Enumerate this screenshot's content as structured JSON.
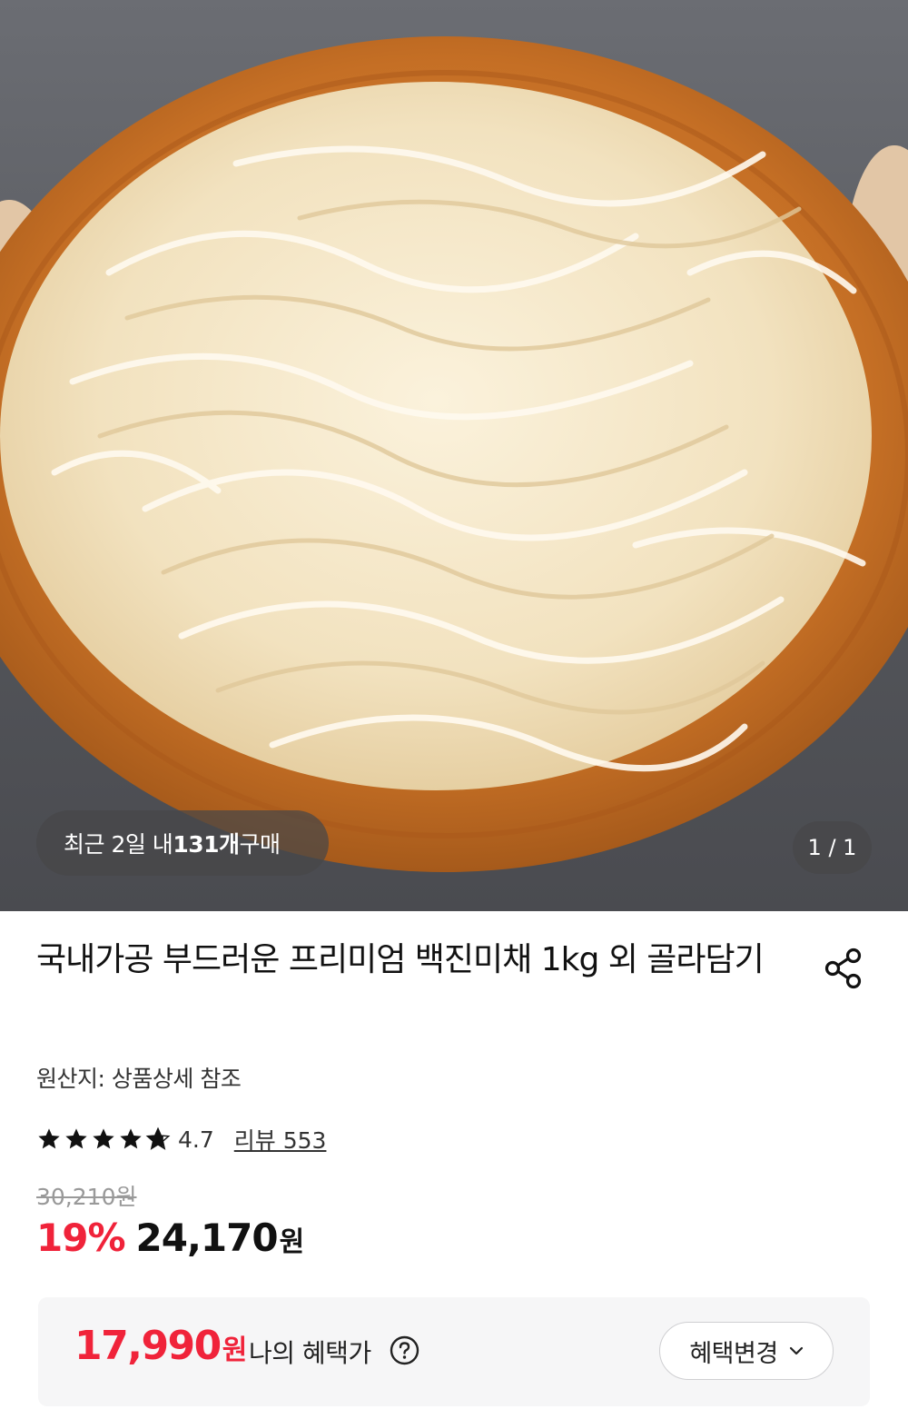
{
  "hero": {
    "image_alt": "wooden plate of shredded dried squid",
    "recent_purchase": {
      "prefix": "최근 2일 내 ",
      "count": "131개",
      "suffix": " 구매"
    },
    "counter": "1 / 1"
  },
  "product": {
    "title": "국내가공 부드러운 프리미엄 백진미채 1kg 외 골라담기",
    "origin": "원산지: 상품상세 참조",
    "rating": "4.7",
    "rating_value": 4.7,
    "review_link": "리뷰 553",
    "original_price": "30,210원",
    "discount": "19%",
    "price": "24,170",
    "price_unit": "원"
  },
  "benefit": {
    "price": "17,990",
    "unit": "원",
    "label": "나의 혜택가",
    "change_button": "혜택변경"
  },
  "colors": {
    "accent": "#f0233a",
    "text": "#111111",
    "muted": "#999999",
    "panel": "#f6f6f7"
  },
  "icons": {
    "share": "share-icon",
    "help": "question-circle-icon",
    "dropdown": "chevron-down-icon",
    "star": "star-icon"
  }
}
